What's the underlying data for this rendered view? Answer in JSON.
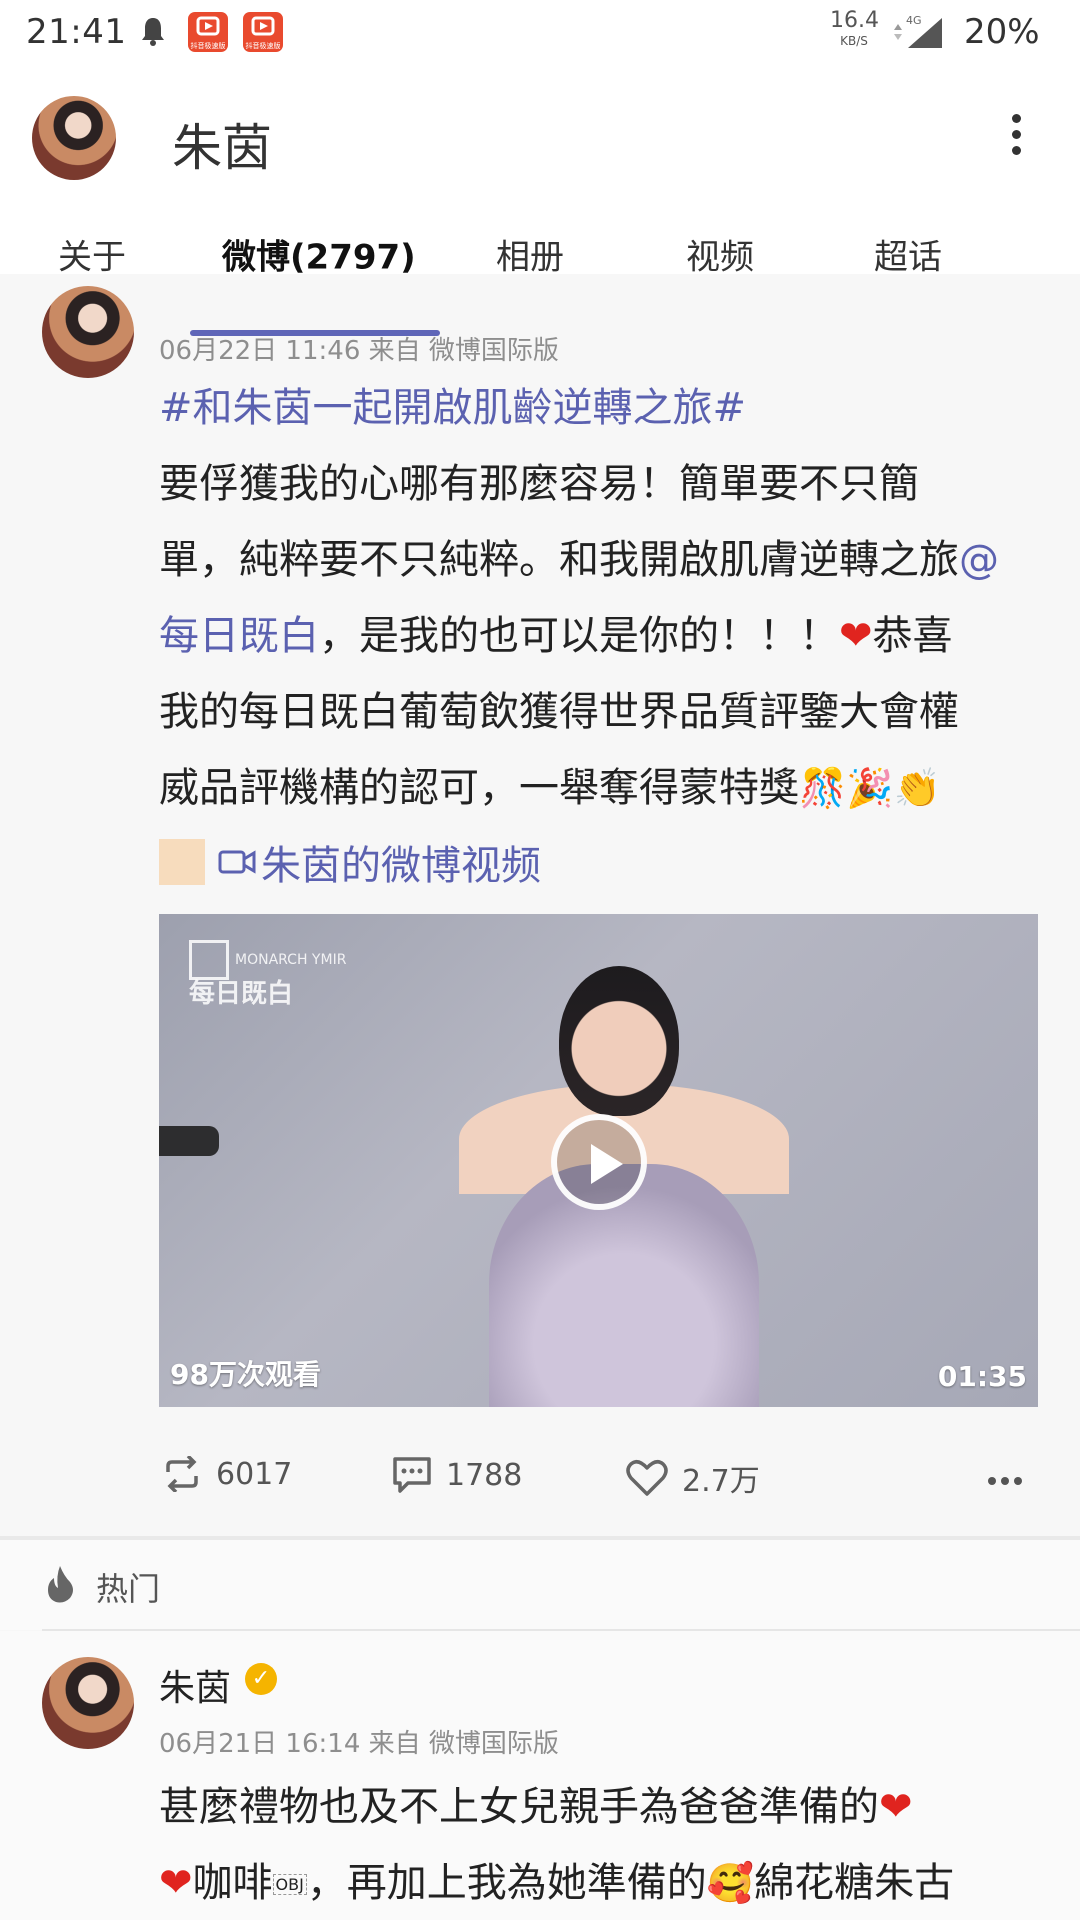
{
  "status_bar": {
    "time": "21:41",
    "app_icon_text": "抖音极速版",
    "net_speed": "16.4",
    "net_unit": "KB/S",
    "network": "4G",
    "battery": "20%",
    "icons": [
      "bell-icon",
      "signal-icon"
    ]
  },
  "header": {
    "title": "朱茵",
    "tabs": [
      "关于",
      "微博(2797)",
      "相册",
      "视频",
      "超话"
    ],
    "active_tab": "微博(2797)",
    "accent_color": "#5f66b8"
  },
  "post1": {
    "meta": "06月22日 11:46  来自 微博国际版",
    "topic": "#和朱茵一起開啟肌齡逆轉之旅#",
    "line1": "要俘獲我的心哪有那麼容易！簡單要不只簡",
    "line2a": "單，純粹要不只純粹。和我開啟肌膚逆轉之旅",
    "line2b": "@",
    "line3a": "每日既白",
    "line3b": "，是我的也可以是你的！！！",
    "line3c": "恭喜",
    "line4": "我的每日既白葡萄飲獲得世界品質評鑒大會權",
    "line5": "威品評機構的認可，一舉奪得蒙特獎",
    "video_link": "朱茵的微博视频",
    "video": {
      "watermark_en": "MONARCH YMIR",
      "watermark_cn": "每日既白",
      "views": "98万次观看",
      "duration": "01:35"
    },
    "actions": {
      "repost": "6017",
      "comment": "1788",
      "like": "2.7万"
    }
  },
  "hot": {
    "label": "热门"
  },
  "post2": {
    "name": "朱茵",
    "meta": "06月21日 16:14  来自 微博国际版",
    "line1": "甚麼禮物也及不上女兒親手為爸爸準備的",
    "line2a": "咖啡",
    "line2b": "，再加上我為她準備的",
    "line2c": "綿花糖朱古"
  }
}
